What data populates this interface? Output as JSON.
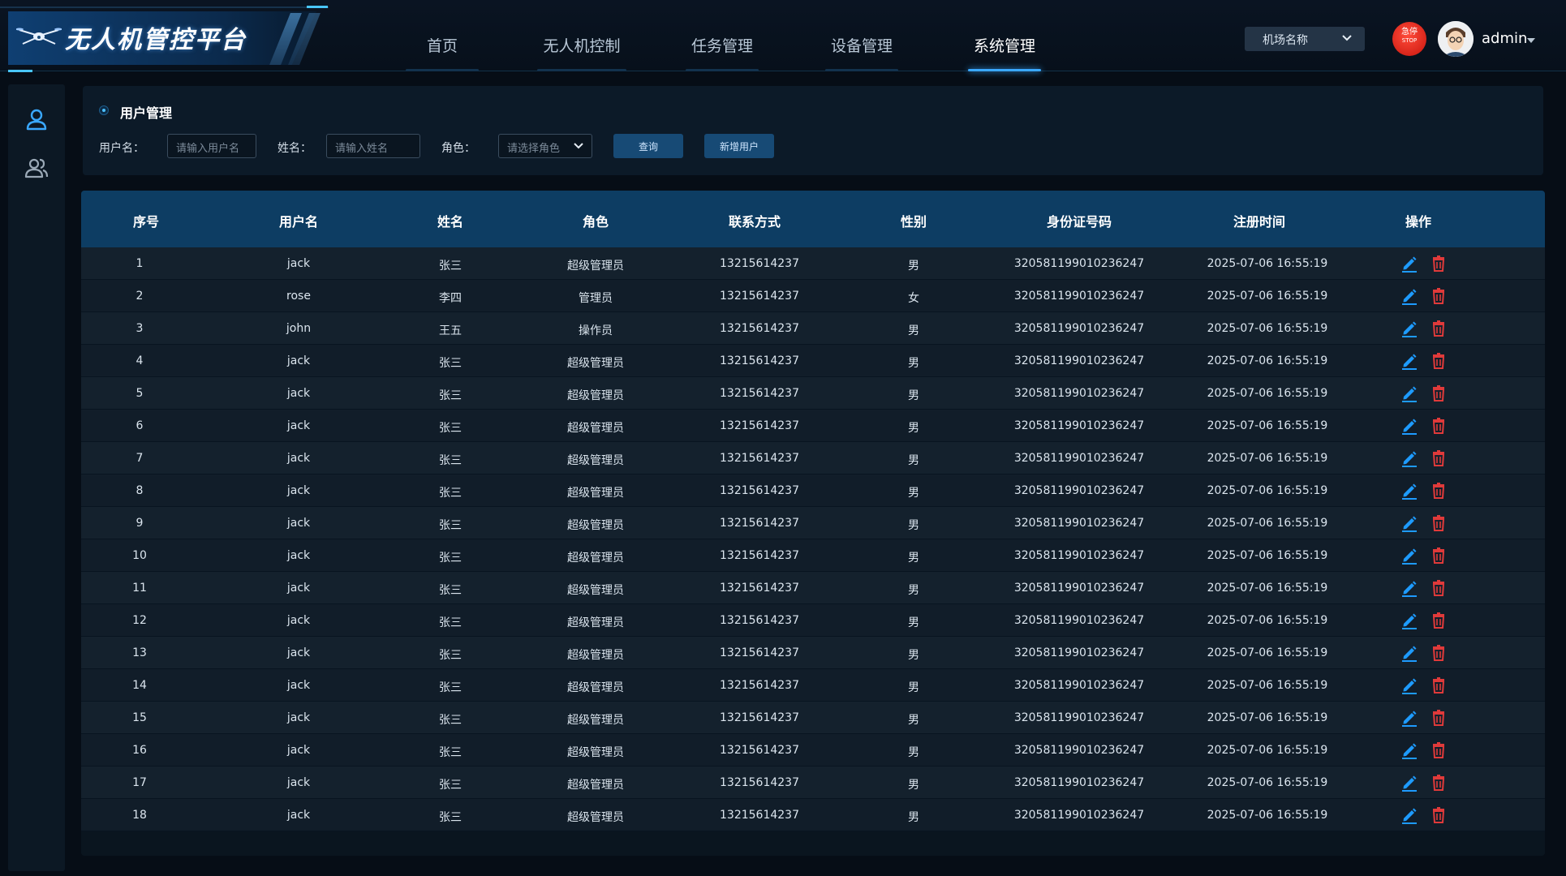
{
  "app": {
    "title": "无人机管控平台"
  },
  "nav": {
    "items": [
      {
        "label": "首页",
        "active": false
      },
      {
        "label": "无人机控制",
        "active": false
      },
      {
        "label": "任务管理",
        "active": false
      },
      {
        "label": "设备管理",
        "active": false
      },
      {
        "label": "系统管理",
        "active": true
      }
    ]
  },
  "header": {
    "airport_select": "机场名称",
    "stop_button": {
      "line1": "急停",
      "line2": "STOP"
    },
    "user": "admin"
  },
  "sidebar": {
    "icons": [
      "user-icon",
      "users-icon"
    ]
  },
  "search": {
    "title": "用户管理",
    "username_label": "用户名：",
    "username_placeholder": "请输入用户名",
    "name_label": "姓名：",
    "name_placeholder": "请输入姓名",
    "role_label": "角色：",
    "role_placeholder": "请选择角色",
    "query_button": "查询",
    "add_button": "新增用户"
  },
  "table": {
    "headers": [
      "序号",
      "用户名",
      "姓名",
      "角色",
      "联系方式",
      "性别",
      "身份证号码",
      "注册时间",
      "操作"
    ],
    "rows": [
      [
        "1",
        "jack",
        "张三",
        "超级管理员",
        "13215614237",
        "男",
        "320581199010236247",
        "2025-07-06 16:55:19"
      ],
      [
        "2",
        "rose",
        "李四",
        "管理员",
        "13215614237",
        "女",
        "320581199010236247",
        "2025-07-06 16:55:19"
      ],
      [
        "3",
        "john",
        "王五",
        "操作员",
        "13215614237",
        "男",
        "320581199010236247",
        "2025-07-06 16:55:19"
      ],
      [
        "4",
        "jack",
        "张三",
        "超级管理员",
        "13215614237",
        "男",
        "320581199010236247",
        "2025-07-06 16:55:19"
      ],
      [
        "5",
        "jack",
        "张三",
        "超级管理员",
        "13215614237",
        "男",
        "320581199010236247",
        "2025-07-06 16:55:19"
      ],
      [
        "6",
        "jack",
        "张三",
        "超级管理员",
        "13215614237",
        "男",
        "320581199010236247",
        "2025-07-06 16:55:19"
      ],
      [
        "7",
        "jack",
        "张三",
        "超级管理员",
        "13215614237",
        "男",
        "320581199010236247",
        "2025-07-06 16:55:19"
      ],
      [
        "8",
        "jack",
        "张三",
        "超级管理员",
        "13215614237",
        "男",
        "320581199010236247",
        "2025-07-06 16:55:19"
      ],
      [
        "9",
        "jack",
        "张三",
        "超级管理员",
        "13215614237",
        "男",
        "320581199010236247",
        "2025-07-06 16:55:19"
      ],
      [
        "10",
        "jack",
        "张三",
        "超级管理员",
        "13215614237",
        "男",
        "320581199010236247",
        "2025-07-06 16:55:19"
      ],
      [
        "11",
        "jack",
        "张三",
        "超级管理员",
        "13215614237",
        "男",
        "320581199010236247",
        "2025-07-06 16:55:19"
      ],
      [
        "12",
        "jack",
        "张三",
        "超级管理员",
        "13215614237",
        "男",
        "320581199010236247",
        "2025-07-06 16:55:19"
      ],
      [
        "13",
        "jack",
        "张三",
        "超级管理员",
        "13215614237",
        "男",
        "320581199010236247",
        "2025-07-06 16:55:19"
      ],
      [
        "14",
        "jack",
        "张三",
        "超级管理员",
        "13215614237",
        "男",
        "320581199010236247",
        "2025-07-06 16:55:19"
      ],
      [
        "15",
        "jack",
        "张三",
        "超级管理员",
        "13215614237",
        "男",
        "320581199010236247",
        "2025-07-06 16:55:19"
      ],
      [
        "16",
        "jack",
        "张三",
        "超级管理员",
        "13215614237",
        "男",
        "320581199010236247",
        "2025-07-06 16:55:19"
      ],
      [
        "17",
        "jack",
        "张三",
        "超级管理员",
        "13215614237",
        "男",
        "320581199010236247",
        "2025-07-06 16:55:19"
      ],
      [
        "18",
        "jack",
        "张三",
        "超级管理员",
        "13215614237",
        "男",
        "320581199010236247",
        "2025-07-06 16:55:19"
      ]
    ],
    "row_actions": [
      "edit-icon",
      "delete-icon"
    ]
  },
  "colors": {
    "accent": "#3aa8ff",
    "edit": "#1e9bff",
    "delete": "#e03a3a",
    "stop": "#e0241a",
    "table_header": "#0d3d63"
  }
}
